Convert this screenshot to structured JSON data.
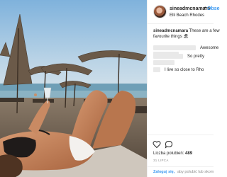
{
  "post": {
    "username": "sineadmcnamara",
    "follow_separator": "•",
    "follow_label": "Obse",
    "location": "Elli Beach Rhodes",
    "photo_description_icon": "beach-photo"
  },
  "caption": {
    "username": "sineadmcnamara",
    "line1": "These are a few",
    "line2": "favourite things 🏖",
    "emoji": "🏖"
  },
  "comments": [
    {
      "text": "Awesome"
    },
    {
      "text": "So pretty"
    },
    {
      "text": "I live so close to Rho"
    }
  ],
  "stats": {
    "likes_label": "Liczba polubień:",
    "likes_count": "489",
    "date": "31 LIPCA"
  },
  "login": {
    "link": "Zaloguj się,",
    "rest": "aby polubić lub skom"
  },
  "icons": [
    "heart-icon",
    "comment-icon"
  ],
  "colors": {
    "link": "#3897f0",
    "sky": "#8ab6d8",
    "sea": "#5c8fa6"
  }
}
